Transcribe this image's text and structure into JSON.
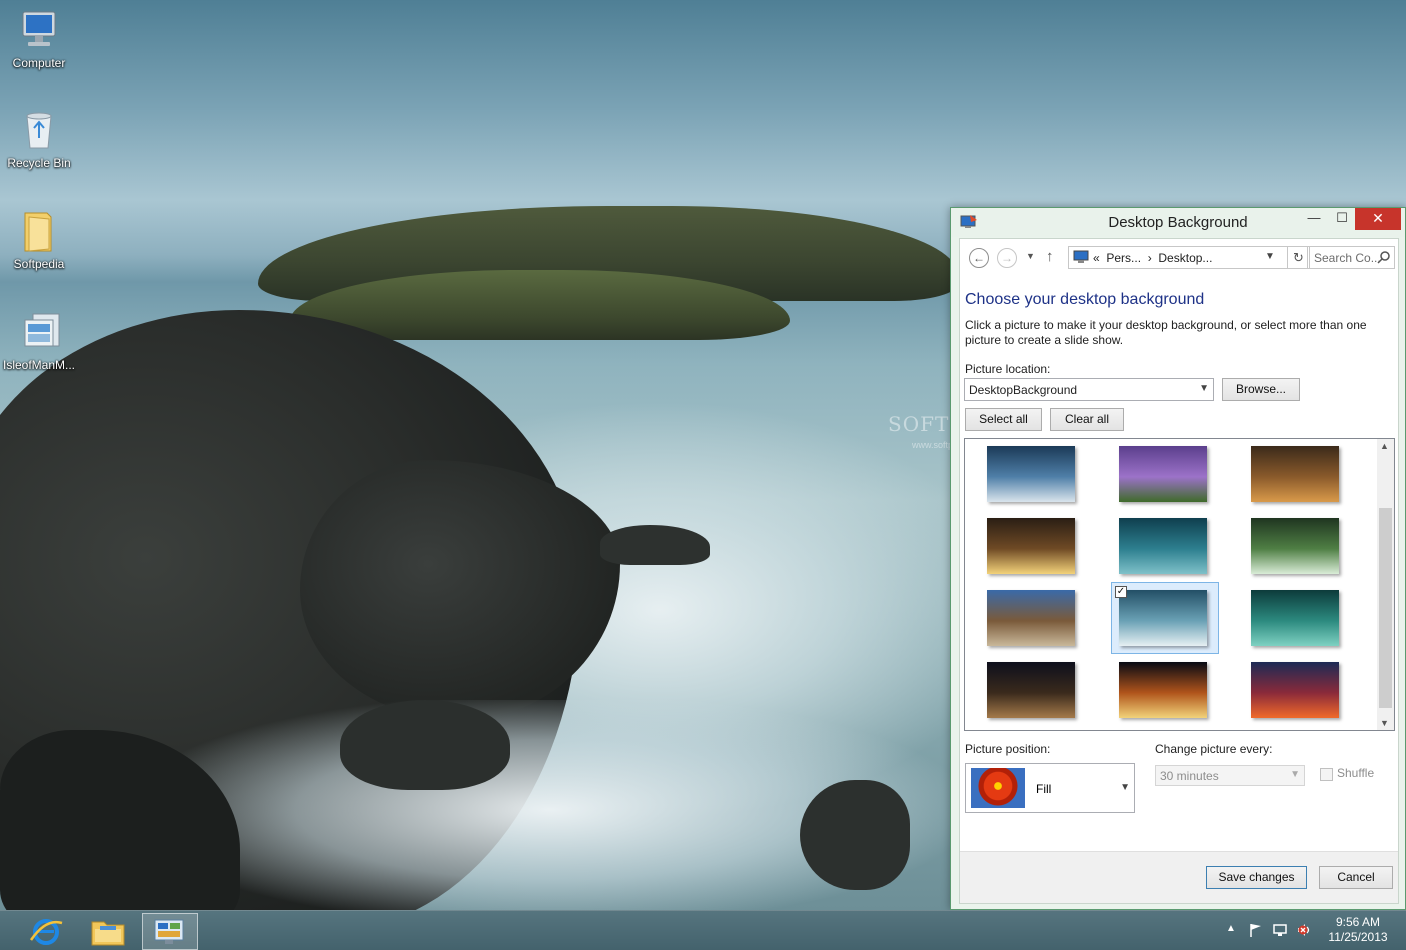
{
  "desktop": {
    "icons": [
      {
        "label": "Computer",
        "icon": "computer-icon"
      },
      {
        "label": "Recycle Bin",
        "icon": "recycle-bin-icon"
      },
      {
        "label": "Softpedia",
        "icon": "folder-icon"
      },
      {
        "label": "IsleofManM...",
        "icon": "theme-pack-icon"
      }
    ],
    "watermark": "SOFTPEDIA",
    "watermark_sub": "www.softpedia.com"
  },
  "dialog": {
    "title": "Desktop Background",
    "controls": {
      "minimize": "—",
      "maximize": "☐",
      "close": "✕"
    },
    "address": {
      "prefix": "«",
      "crumb1": "Pers...",
      "separator": "›",
      "crumb2": "Desktop..."
    },
    "search_placeholder": "Search Co...",
    "heading": "Choose your desktop background",
    "description": "Click a picture to make it your desktop background, or select more than one picture to create a slide show.",
    "picture_location_label": "Picture location:",
    "picture_location_value": "DesktopBackground",
    "browse_label": "Browse...",
    "select_all_label": "Select all",
    "clear_all_label": "Clear all",
    "thumbnails": [
      {
        "name": "castle-cliffs",
        "colors": [
          "#1b3a57",
          "#4f7fa8",
          "#d9e4ec"
        ]
      },
      {
        "name": "purple-tree",
        "colors": [
          "#5b3f8c",
          "#9c72c9",
          "#3f6b2a"
        ]
      },
      {
        "name": "autumn-forest",
        "colors": [
          "#3b2a1a",
          "#8a5a2b",
          "#d99a4a"
        ]
      },
      {
        "name": "lighthouse-night",
        "colors": [
          "#2a1e14",
          "#6f4a25",
          "#f3d27a"
        ]
      },
      {
        "name": "island-teal",
        "colors": [
          "#0f3f4e",
          "#2d7f8f",
          "#7fc1c9"
        ]
      },
      {
        "name": "waterfall",
        "colors": [
          "#1f3520",
          "#4f7f44",
          "#d9ecd7"
        ]
      },
      {
        "name": "viaduct",
        "colors": [
          "#3a6aa8",
          "#7a5a3a",
          "#c9b89a"
        ]
      },
      {
        "name": "island-surf",
        "colors": [
          "#234f66",
          "#6aa1b5",
          "#e6f0f3"
        ]
      },
      {
        "name": "teal-coast",
        "colors": [
          "#0c3b3b",
          "#2c8a7f",
          "#7fd1c2"
        ]
      },
      {
        "name": "star-trails",
        "colors": [
          "#0d0f1c",
          "#3a2a1c",
          "#a47a4a"
        ]
      },
      {
        "name": "fireworks",
        "colors": [
          "#070a14",
          "#b0541b",
          "#f2d27a"
        ]
      },
      {
        "name": "sunset-dusk",
        "colors": [
          "#1c2a55",
          "#8a2a3a",
          "#f06a2a"
        ]
      }
    ],
    "selected_index": 7,
    "picture_position_label": "Picture position:",
    "picture_position_value": "Fill",
    "change_every_label": "Change picture every:",
    "change_every_value": "30 minutes",
    "shuffle_label": "Shuffle",
    "save_label": "Save changes",
    "cancel_label": "Cancel"
  },
  "taskbar": {
    "pinned": [
      "internet-explorer-icon",
      "file-explorer-icon",
      "control-panel-icon"
    ],
    "tray": [
      "action-center-flag-icon",
      "network-icon",
      "volume-icon",
      "power-warning-icon"
    ],
    "time": "9:56 AM",
    "date": "11/25/2013"
  }
}
